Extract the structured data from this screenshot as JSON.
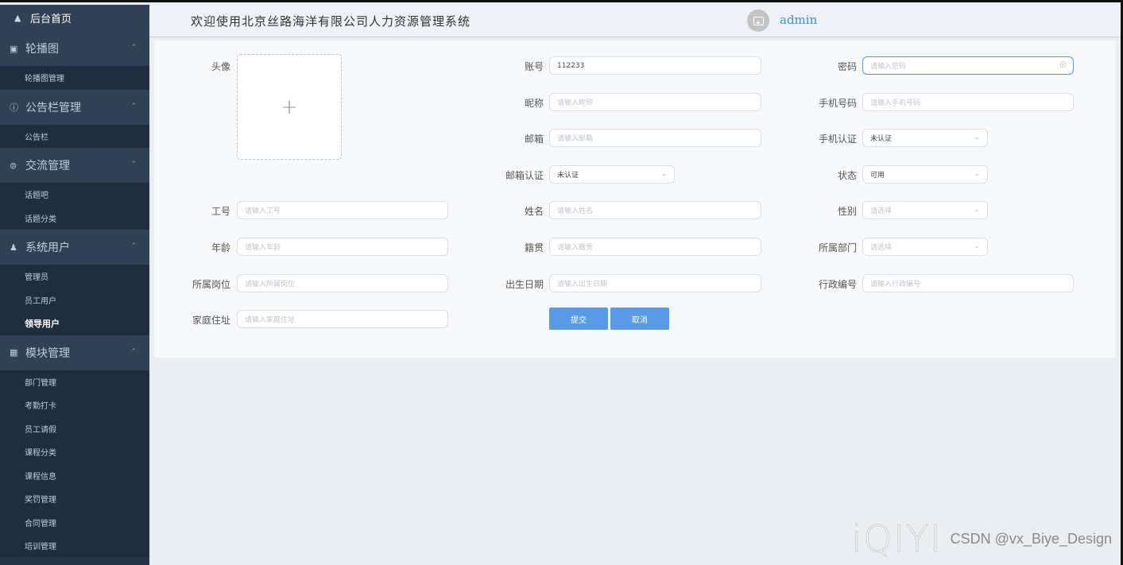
{
  "header": {
    "title": "欢迎使用北京丝路海洋有限公司人力资源管理系统",
    "username": "admin"
  },
  "sidebar": {
    "home": "后台首页",
    "groups": [
      {
        "label": "轮播图",
        "icon": "image-icon",
        "items": [
          "轮播图管理"
        ]
      },
      {
        "label": "公告栏管理",
        "icon": "info-circle-icon",
        "items": [
          "公告栏"
        ]
      },
      {
        "label": "交流管理",
        "icon": "chat-icon",
        "items": [
          "话题吧",
          "话题分类"
        ]
      },
      {
        "label": "系统用户",
        "icon": "user-icon",
        "items": [
          "管理员",
          "员工用户",
          "领导用户"
        ]
      },
      {
        "label": "模块管理",
        "icon": "grid-icon",
        "items": [
          "部门管理",
          "考勤打卡",
          "员工请假",
          "课程分类",
          "课程信息",
          "奖罚管理",
          "合同管理",
          "培训管理"
        ]
      }
    ],
    "active_item": "领导用户"
  },
  "form": {
    "avatar_label": "头像",
    "upload_plus": "+",
    "account_label": "账号",
    "account_value": "112233",
    "password_label": "密码",
    "password_placeholder": "请输入密码",
    "nickname_label": "昵称",
    "nickname_placeholder": "请输入昵称",
    "phone_label": "手机号码",
    "phone_placeholder": "请输入手机号码",
    "email_label": "邮箱",
    "email_placeholder": "请输入邮箱",
    "phone_verify_label": "手机认证",
    "phone_verify_value": "未认证",
    "email_verify_label": "邮箱认证",
    "email_verify_value": "未认证",
    "status_label": "状态",
    "status_value": "可用",
    "job_no_label": "工号",
    "job_no_placeholder": "请输入工号",
    "name_label": "姓名",
    "name_placeholder": "请输入姓名",
    "gender_label": "性别",
    "gender_placeholder": "请选择",
    "age_label": "年龄",
    "age_placeholder": "请输入年龄",
    "native_label": "籍贯",
    "native_placeholder": "请输入籍贯",
    "dept_label": "所属部门",
    "dept_placeholder": "请选择",
    "post_label": "所属岗位",
    "post_placeholder": "请输入所属岗位",
    "birth_label": "出生日期",
    "birth_placeholder": "请输入出生日期",
    "admin_no_label": "行政编号",
    "admin_no_placeholder": "请输入行政编号",
    "address_label": "家庭住址",
    "address_placeholder": "请输入家庭住址",
    "submit_label": "提交",
    "cancel_label": "取消"
  },
  "watermark": {
    "logo": "iQIYI",
    "text": "CSDN @vx_Biye_Design"
  },
  "colors": {
    "sidebar_bg": "#263445",
    "submenu_bg": "#1f2d3d",
    "accent": "#409eff",
    "button": "#5a9ae6"
  }
}
